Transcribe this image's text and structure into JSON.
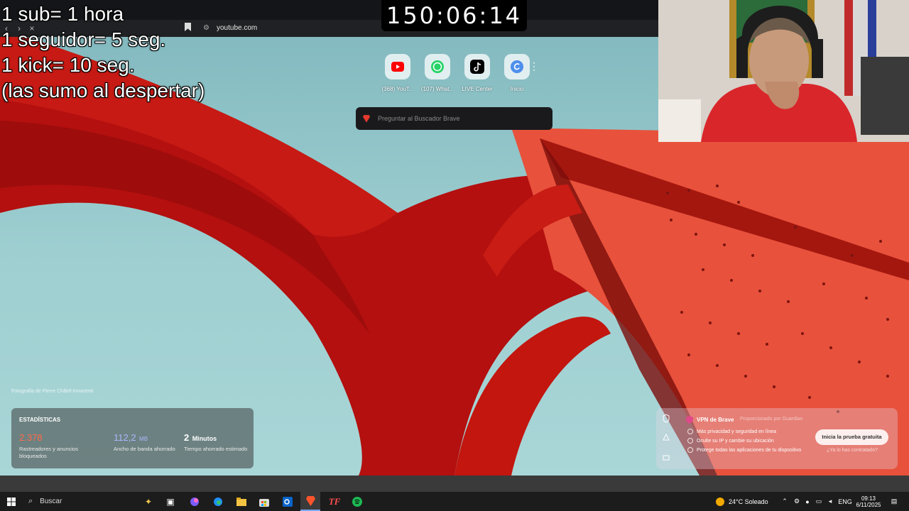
{
  "stream_overlay": {
    "rules_lines": [
      "1 sub= 1 hora",
      "1 seguidor= 5 seg.",
      "1 kick= 10 seg.",
      "(las sumo al despertar)"
    ],
    "timer": "150:06:14"
  },
  "browser": {
    "url": "youtube.com",
    "shortcuts": [
      {
        "label": "(368) YouT...",
        "icon": "youtube-icon"
      },
      {
        "label": "(107) What...",
        "icon": "whatsapp-icon"
      },
      {
        "label": "LIVE Center",
        "icon": "tiktok-icon"
      },
      {
        "label": "Inicio",
        "icon": "canva-icon"
      }
    ],
    "search_placeholder": "Preguntar al Buscador Brave",
    "photo_credit": "Fotografía de Pierre Châtel-Innocenti"
  },
  "stats": {
    "title": "ESTADÍSTICAS",
    "items": [
      {
        "value": "2.378",
        "unit": "",
        "desc": "Rastreadores y anuncios bloqueados",
        "color": "#ff6b4a"
      },
      {
        "value": "112,2",
        "unit": "MB",
        "desc": "Ancho de banda ahorrado",
        "color": "#a9b8ff"
      },
      {
        "value": "2",
        "unit": "Minutos",
        "desc": "Tiempo ahorrado estimado",
        "color": "#ffffff"
      }
    ]
  },
  "vpn": {
    "title": "VPN de Brave",
    "powered_by": "Proporcionado por  Guardian",
    "features": [
      "Más privacidad y seguridad en línea",
      "Oculte su IP y cambie su ubicación",
      "Protege todas las aplicaciones de tu dispositivo"
    ],
    "trial_button": "Inicia la prueba gratuita",
    "already_contracted": "¿Ya lo has contratado?"
  },
  "taskbar": {
    "search_label": "Buscar",
    "weather": "24°C Soleado",
    "language": "ENG",
    "time": "09:13",
    "date": "6/11/2025"
  }
}
